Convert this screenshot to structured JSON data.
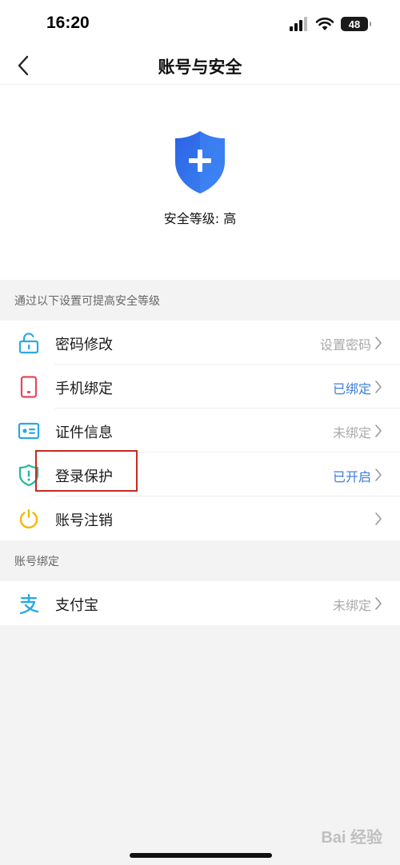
{
  "status_bar": {
    "time": "16:20",
    "battery": "48",
    "icons": [
      "signal-icon",
      "wifi-icon",
      "battery-icon"
    ]
  },
  "nav": {
    "title": "账号与安全",
    "back_icon": "chevron-left-icon"
  },
  "header": {
    "security_level": "安全等级: 高",
    "shield_color": "#2f6fea"
  },
  "sections": {
    "improve_label": "通过以下设置可提高安全等级",
    "binding_label": "账号绑定"
  },
  "security_items": [
    {
      "label": "密码修改",
      "value": "设置密码",
      "value_color": "gray",
      "icon": "lock-open-icon"
    },
    {
      "label": "手机绑定",
      "value": "已绑定",
      "value_color": "blue",
      "icon": "phone-icon"
    },
    {
      "label": "证件信息",
      "value": "未绑定",
      "value_color": "gray",
      "icon": "id-card-icon"
    },
    {
      "label": "登录保护",
      "value": "已开启",
      "value_color": "blue",
      "icon": "shield-alert-icon"
    },
    {
      "label": "账号注销",
      "value": "",
      "value_color": "gray",
      "icon": "power-icon"
    }
  ],
  "binding_items": [
    {
      "label": "支付宝",
      "value": "未绑定",
      "value_color": "gray",
      "icon": "alipay-icon"
    }
  ],
  "watermark": {
    "text": "Bai 经验"
  },
  "colors": {
    "accent_blue": "#3b7ddd",
    "highlight_red": "#c62a22"
  }
}
